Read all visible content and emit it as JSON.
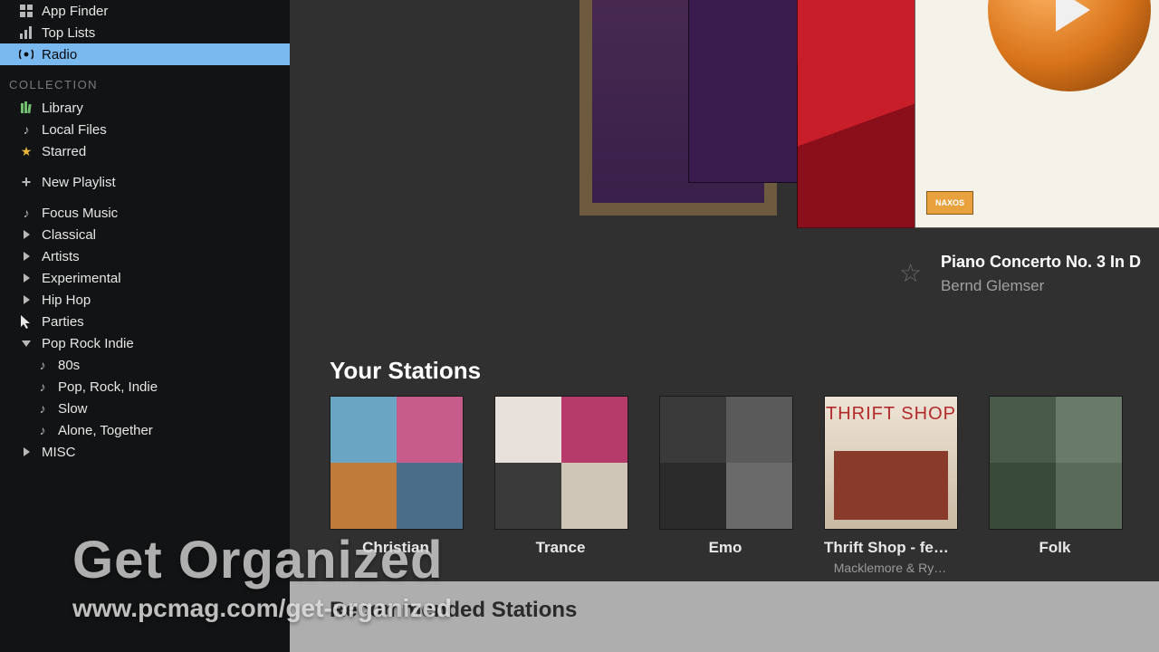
{
  "sidebar": {
    "top": [
      {
        "icon": "grid",
        "label": "App Finder"
      },
      {
        "icon": "bars",
        "label": "Top Lists"
      },
      {
        "icon": "radio",
        "label": "Radio",
        "selected": true
      }
    ],
    "collection_header": "COLLECTION",
    "collection": [
      {
        "icon": "lib",
        "label": "Library"
      },
      {
        "icon": "note",
        "label": "Local Files"
      },
      {
        "icon": "star",
        "label": "Starred"
      }
    ],
    "new_playlist": {
      "label": "New Playlist"
    },
    "playlists": [
      {
        "kind": "note",
        "label": "Focus Music"
      },
      {
        "kind": "fold",
        "label": "Classical"
      },
      {
        "kind": "fold",
        "label": "Artists"
      },
      {
        "kind": "fold",
        "label": "Experimental"
      },
      {
        "kind": "fold",
        "label": "Hip Hop"
      },
      {
        "kind": "fold-cursor",
        "label": "Parties"
      },
      {
        "kind": "fold-open",
        "label": "Pop Rock Indie"
      },
      {
        "kind": "note sub",
        "label": "80s"
      },
      {
        "kind": "note sub",
        "label": "Pop, Rock, Indie"
      },
      {
        "kind": "note sub",
        "label": "Slow"
      },
      {
        "kind": "note sub",
        "label": "Alone, Together"
      },
      {
        "kind": "fold",
        "label": "MISC"
      }
    ]
  },
  "now_playing": {
    "title": "Piano Concerto No. 3 In D",
    "artist": "Bernd Glemser",
    "naxos_badge": "NAXOS"
  },
  "your_stations": {
    "header": "Your Stations",
    "items": [
      {
        "title": "Christian",
        "subtitle": ""
      },
      {
        "title": "Trance",
        "subtitle": ""
      },
      {
        "title": "Emo",
        "subtitle": ""
      },
      {
        "title": "Thrift Shop - fea…",
        "subtitle": "Macklemore & Ry…",
        "thrift_text": "THRIFT SHOP"
      },
      {
        "title": "Folk",
        "subtitle": ""
      }
    ]
  },
  "recommended": {
    "header": "Recommended Stations"
  },
  "overlay": {
    "title": "Get Organized",
    "url": "www.pcmag.com/get-organized"
  }
}
